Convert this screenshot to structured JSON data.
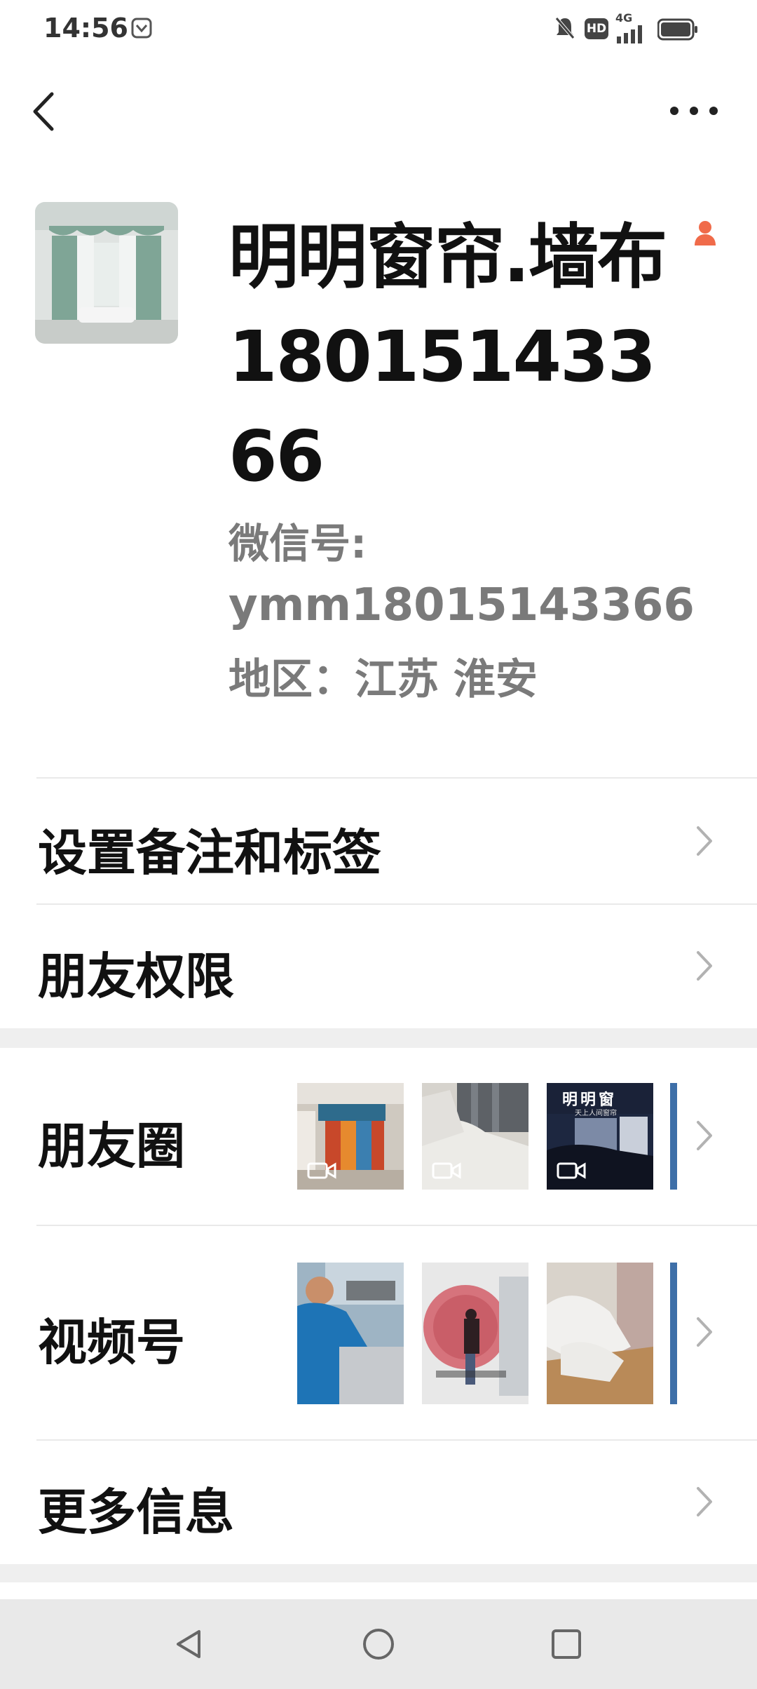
{
  "status_bar": {
    "time": "14:56",
    "network": "4G",
    "hd_badge": "HD",
    "icons": [
      "notification-app-icon",
      "bell-muted-icon",
      "hd-icon",
      "signal-icon",
      "battery-icon"
    ]
  },
  "nav": {
    "back_icon": "chevron-left-icon",
    "more_icon": "more-dots-icon"
  },
  "profile": {
    "nickname": "明明窗帘.墙布18015143366",
    "wechat_id_label": "微信号:",
    "wechat_id": "ymm18015143366",
    "region": "地区：江苏  淮安",
    "gender_icon": "female-person-icon",
    "gender_color": "#f06b4a"
  },
  "menu": {
    "remark_tags": "设置备注和标签",
    "friend_permissions": "朋友权限",
    "moments": "朋友圈",
    "channels": "视频号",
    "more_info": "更多信息"
  },
  "moments_thumbs": [
    {
      "name": "moments-thumb-1",
      "video": true
    },
    {
      "name": "moments-thumb-2",
      "video": true
    },
    {
      "name": "moments-thumb-3",
      "video": true,
      "shop_sign": "明明窗",
      "shop_sub": "天上人间窗帘"
    }
  ],
  "channels_thumbs": [
    {
      "name": "channels-thumb-1"
    },
    {
      "name": "channels-thumb-2"
    },
    {
      "name": "channels-thumb-3"
    }
  ],
  "colors": {
    "background": "#ffffff",
    "section_gap": "#efefef",
    "secondary_text": "#7a7a7a",
    "nav_bar": "#e9e9e9"
  }
}
